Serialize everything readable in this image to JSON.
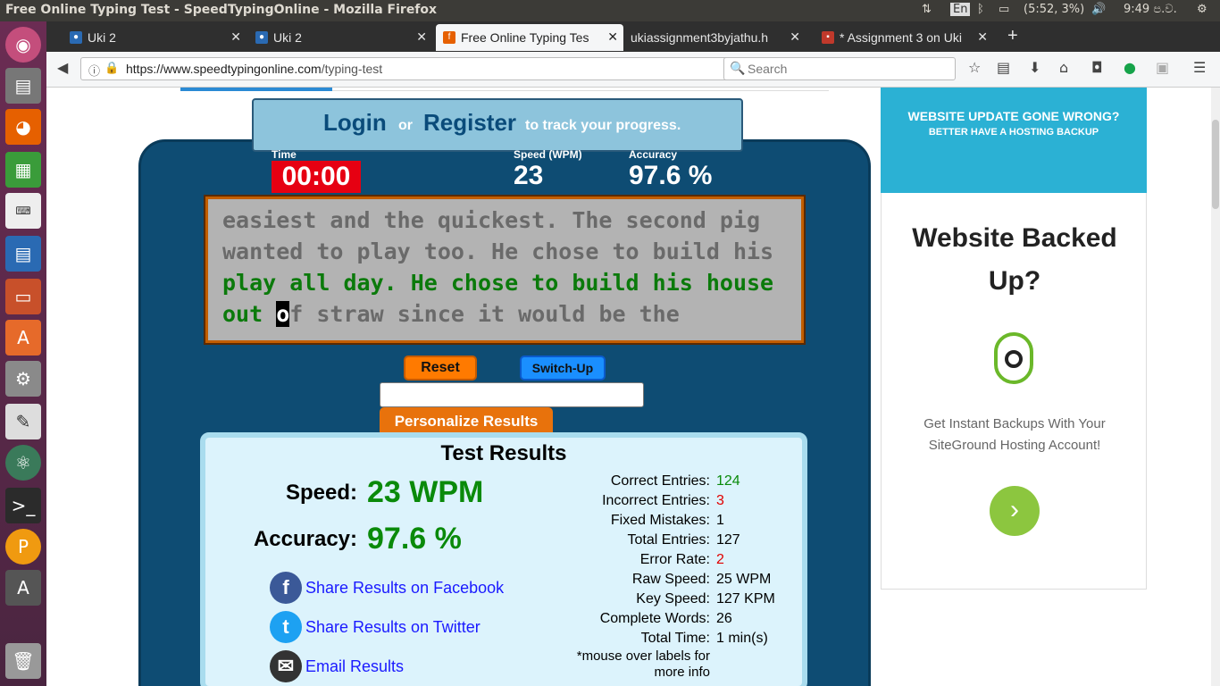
{
  "topbar": {
    "window_title": "Free Online Typing Test - SpeedTypingOnline - Mozilla Firefox",
    "lang": "En",
    "battery": "(5:52, 3%)",
    "time": "9:49 ප.ව."
  },
  "tabs": [
    {
      "label": "Uki 2",
      "active": false
    },
    {
      "label": "Uki 2",
      "active": false
    },
    {
      "label": "Free Online Typing Tes",
      "active": true
    },
    {
      "label": "ukiassignment3byjathu.h",
      "active": false
    },
    {
      "label": "* Assignment 3 on Uki",
      "active": false
    }
  ],
  "nav": {
    "url_host": "https://www.speedtypingonline.com",
    "url_path": "/typing-test",
    "search_placeholder": "Search"
  },
  "login": {
    "login_label": "Login",
    "or_label": "or",
    "register_label": "Register",
    "tail": "to track your progress."
  },
  "stats_bar": {
    "time_label": "Time",
    "time_value": "00:00",
    "speed_label": "Speed (WPM)",
    "speed_value": "23",
    "accuracy_label": "Accuracy",
    "accuracy_value": "97.6 %"
  },
  "typing_text": {
    "line1": "easiest and the quickest. The second pig",
    "line2": "wanted to play too. He chose to build his",
    "line3_typed": "play all day. He chose to build his house",
    "line4_typed": "out ",
    "cursor_char": "o",
    "line4_rest": "f straw since it would be the"
  },
  "buttons": {
    "reset": "Reset",
    "switch_up": "Switch-Up",
    "personalize": "Personalize Results"
  },
  "results": {
    "title": "Test Results",
    "speed_label": "Speed:",
    "speed_value": "23 WPM",
    "accuracy_label": "Accuracy:",
    "accuracy_value": "97.6 %",
    "share_facebook": "Share Results on Facebook",
    "share_twitter": "Share Results on Twitter",
    "email": "Email Results",
    "stats": [
      {
        "label": "Correct Entries:",
        "value": "124",
        "color": "#0a8a0a"
      },
      {
        "label": "Incorrect Entries:",
        "value": "3",
        "color": "#e00000"
      },
      {
        "label": "Fixed Mistakes:",
        "value": "1",
        "color": "#000000"
      },
      {
        "label": "Total Entries:",
        "value": "127",
        "color": "#000000"
      },
      {
        "label": "Error Rate:",
        "value": "2",
        "color": "#e00000"
      },
      {
        "label": "Raw Speed:",
        "value": "25 WPM",
        "color": "#000000"
      },
      {
        "label": "Key Speed:",
        "value": "127 KPM",
        "color": "#000000"
      },
      {
        "label": "Complete Words:",
        "value": "26",
        "color": "#000000"
      },
      {
        "label": "Total Time:",
        "value": "1 min(s)",
        "color": "#000000"
      }
    ],
    "note_line1": "*mouse over labels for",
    "note_line2": "more info"
  },
  "ad": {
    "banner_line1": "WEBSITE UPDATE GONE WRONG?",
    "banner_line2": "BETTER HAVE A HOSTING BACKUP",
    "heading_line1": "Website Backed",
    "heading_line2": "Up?",
    "body_line1": "Get Instant Backups With Your",
    "body_line2": "SiteGround Hosting Account!"
  }
}
